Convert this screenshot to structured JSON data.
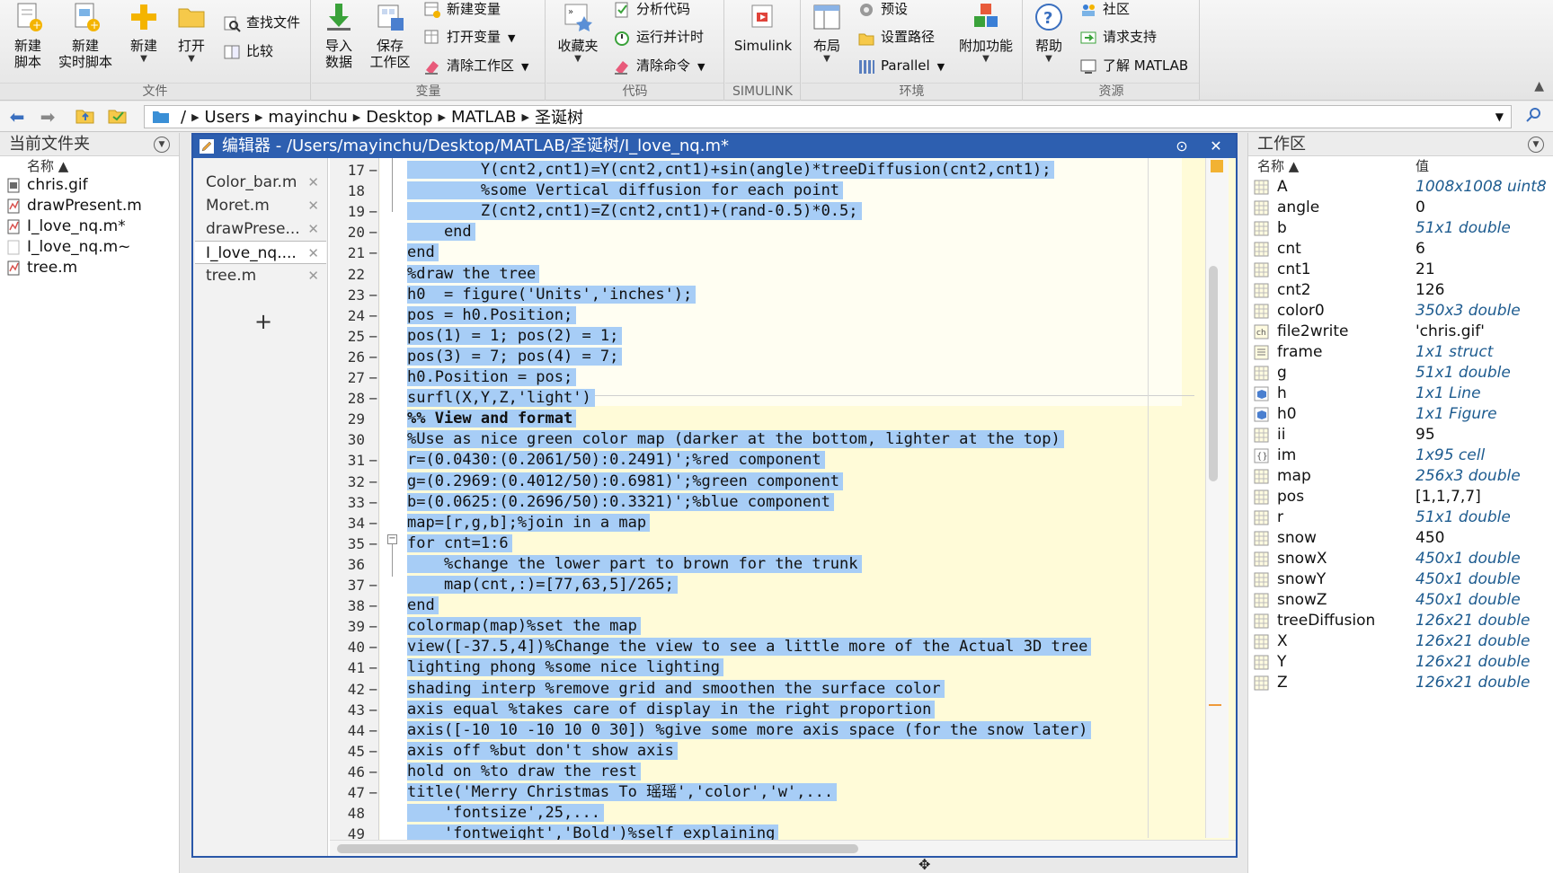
{
  "toolstrip": {
    "sections": {
      "file": "文件",
      "variable": "变量",
      "code": "代码",
      "simulink": "SIMULINK",
      "environment": "环境",
      "resources": "资源"
    },
    "new_script": "新建\n脚本",
    "new_live_script": "新建\n实时脚本",
    "new": "新建",
    "open": "打开",
    "find_files": "查找文件",
    "compare": "比较",
    "import_data": "导入\n数据",
    "save_workspace": "保存\n工作区",
    "new_variable": "新建变量",
    "open_variable": "打开变量",
    "clear_workspace": "清除工作区",
    "favorites": "收藏夹",
    "analyze_code": "分析代码",
    "run_and_time": "运行并计时",
    "clear_commands": "清除命令",
    "simulink": "Simulink",
    "layout": "布局",
    "preferences": "预设",
    "set_path": "设置路径",
    "parallel": "Parallel",
    "addons": "附加功能",
    "help": "帮助",
    "community": "社区",
    "request_support": "请求支持",
    "learn_matlab": "了解 MATLAB"
  },
  "address": {
    "segments": [
      "/",
      "Users",
      "mayinchu",
      "Desktop",
      "MATLAB",
      "圣诞树"
    ]
  },
  "current_folder": {
    "title": "当前文件夹",
    "col_name": "名称 ▲",
    "files": [
      {
        "name": "chris.gif",
        "icon": "gif-file-icon"
      },
      {
        "name": "drawPresent.m",
        "icon": "m-file-icon"
      },
      {
        "name": "I_love_nq.m*",
        "icon": "m-file-icon"
      },
      {
        "name": "I_love_nq.m~",
        "icon": "blank-file-icon"
      },
      {
        "name": "tree.m",
        "icon": "m-file-icon"
      }
    ]
  },
  "editor": {
    "title": "编辑器 - /Users/mayinchu/Desktop/MATLAB/圣诞树/I_love_nq.m*",
    "tabs": [
      {
        "label": "Color_bar.m",
        "active": false
      },
      {
        "label": "Moret.m",
        "active": false
      },
      {
        "label": "drawPrese...",
        "active": false
      },
      {
        "label": "I_love_nq....",
        "active": true
      },
      {
        "label": "tree.m",
        "active": false
      }
    ],
    "add_tab": "+",
    "lines": [
      {
        "n": "17",
        "dash": true,
        "code": "        Y(cnt2,cnt1)=Y(cnt2,cnt1)+sin(angle)*treeDiffusion(cnt2,cnt1);"
      },
      {
        "n": "18",
        "dash": false,
        "code": "        %some Vertical diffusion for each point"
      },
      {
        "n": "19",
        "dash": true,
        "code": "        Z(cnt2,cnt1)=Z(cnt2,cnt1)+(rand-0.5)*0.5;"
      },
      {
        "n": "20",
        "dash": true,
        "code": "    end"
      },
      {
        "n": "21",
        "dash": true,
        "code": "end"
      },
      {
        "n": "22",
        "dash": false,
        "code": "%draw the tree"
      },
      {
        "n": "23",
        "dash": true,
        "code": "h0  = figure('Units','inches');"
      },
      {
        "n": "24",
        "dash": true,
        "code": "pos = h0.Position;"
      },
      {
        "n": "25",
        "dash": true,
        "code": "pos(1) = 1; pos(2) = 1;"
      },
      {
        "n": "26",
        "dash": true,
        "code": "pos(3) = 7; pos(4) = 7;"
      },
      {
        "n": "27",
        "dash": true,
        "code": "h0.Position = pos;"
      },
      {
        "n": "28",
        "dash": true,
        "code": "surfl(X,Y,Z,'light')"
      },
      {
        "n": "29",
        "dash": false,
        "code": "%% View and format",
        "cell": true
      },
      {
        "n": "30",
        "dash": false,
        "code": "%Use as nice green color map (darker at the bottom, lighter at the top)"
      },
      {
        "n": "31",
        "dash": true,
        "code": "r=(0.0430:(0.2061/50):0.2491)';%red component"
      },
      {
        "n": "32",
        "dash": true,
        "code": "g=(0.2969:(0.4012/50):0.6981)';%green component"
      },
      {
        "n": "33",
        "dash": true,
        "code": "b=(0.0625:(0.2696/50):0.3321)';%blue component"
      },
      {
        "n": "34",
        "dash": true,
        "code": "map=[r,g,b];%join in a map"
      },
      {
        "n": "35",
        "dash": true,
        "code": "for cnt=1:6"
      },
      {
        "n": "36",
        "dash": false,
        "code": "    %change the lower part to brown for the trunk"
      },
      {
        "n": "37",
        "dash": true,
        "code": "    map(cnt,:)=[77,63,5]/265;"
      },
      {
        "n": "38",
        "dash": true,
        "code": "end"
      },
      {
        "n": "39",
        "dash": true,
        "code": "colormap(map)%set the map"
      },
      {
        "n": "40",
        "dash": true,
        "code": "view([-37.5,4])%Change the view to see a little more of the Actual 3D tree"
      },
      {
        "n": "41",
        "dash": true,
        "code": "lighting phong %some nice lighting"
      },
      {
        "n": "42",
        "dash": true,
        "code": "shading interp %remove grid and smoothen the surface color"
      },
      {
        "n": "43",
        "dash": true,
        "code": "axis equal %takes care of display in the right proportion"
      },
      {
        "n": "44",
        "dash": true,
        "code": "axis([-10 10 -10 10 0 30]) %give some more axis space (for the snow later)"
      },
      {
        "n": "45",
        "dash": true,
        "code": "axis off %but don't show axis"
      },
      {
        "n": "46",
        "dash": true,
        "code": "hold on %to draw the rest"
      },
      {
        "n": "47",
        "dash": true,
        "code": "title('Merry Christmas To 瑶瑶','color','w',..."
      },
      {
        "n": "48",
        "dash": false,
        "code": "    'fontsize',25,..."
      },
      {
        "n": "49",
        "dash": false,
        "code": "    'fontweight','Bold')%self explaining"
      }
    ]
  },
  "workspace": {
    "title": "工作区",
    "col_name": "名称 ▲",
    "col_value": "值",
    "vars": [
      {
        "name": "A",
        "value": "1008x1008 uint8",
        "italic": true,
        "icon": "array-icon"
      },
      {
        "name": "angle",
        "value": "0",
        "italic": false,
        "icon": "array-icon"
      },
      {
        "name": "b",
        "value": "51x1 double",
        "italic": true,
        "icon": "array-icon"
      },
      {
        "name": "cnt",
        "value": "6",
        "italic": false,
        "icon": "array-icon"
      },
      {
        "name": "cnt1",
        "value": "21",
        "italic": false,
        "icon": "array-icon"
      },
      {
        "name": "cnt2",
        "value": "126",
        "italic": false,
        "icon": "array-icon"
      },
      {
        "name": "color0",
        "value": "350x3 double",
        "italic": true,
        "icon": "array-icon"
      },
      {
        "name": "file2write",
        "value": "'chris.gif'",
        "italic": false,
        "icon": "char-icon"
      },
      {
        "name": "frame",
        "value": "1x1 struct",
        "italic": true,
        "icon": "struct-icon"
      },
      {
        "name": "g",
        "value": "51x1 double",
        "italic": true,
        "icon": "array-icon"
      },
      {
        "name": "h",
        "value": "1x1 Line",
        "italic": true,
        "icon": "object-icon"
      },
      {
        "name": "h0",
        "value": "1x1 Figure",
        "italic": true,
        "icon": "object-icon"
      },
      {
        "name": "ii",
        "value": "95",
        "italic": false,
        "icon": "array-icon"
      },
      {
        "name": "im",
        "value": "1x95 cell",
        "italic": true,
        "icon": "cell-icon"
      },
      {
        "name": "map",
        "value": "256x3 double",
        "italic": true,
        "icon": "array-icon"
      },
      {
        "name": "pos",
        "value": "[1,1,7,7]",
        "italic": false,
        "icon": "array-icon"
      },
      {
        "name": "r",
        "value": "51x1 double",
        "italic": true,
        "icon": "array-icon"
      },
      {
        "name": "snow",
        "value": "450",
        "italic": false,
        "icon": "array-icon"
      },
      {
        "name": "snowX",
        "value": "450x1 double",
        "italic": true,
        "icon": "array-icon"
      },
      {
        "name": "snowY",
        "value": "450x1 double",
        "italic": true,
        "icon": "array-icon"
      },
      {
        "name": "snowZ",
        "value": "450x1 double",
        "italic": true,
        "icon": "array-icon"
      },
      {
        "name": "treeDiffusion",
        "value": "126x21 double",
        "italic": true,
        "icon": "array-icon"
      },
      {
        "name": "X",
        "value": "126x21 double",
        "italic": true,
        "icon": "array-icon"
      },
      {
        "name": "Y",
        "value": "126x21 double",
        "italic": true,
        "icon": "array-icon"
      },
      {
        "name": "Z",
        "value": "126x21 double",
        "italic": true,
        "icon": "array-icon"
      }
    ]
  },
  "colors": {
    "accent": "#2d5fb0",
    "selection": "#a7cdf6",
    "editor_bg": "#fffbd8",
    "workspace_value": "#1d5b8f"
  }
}
